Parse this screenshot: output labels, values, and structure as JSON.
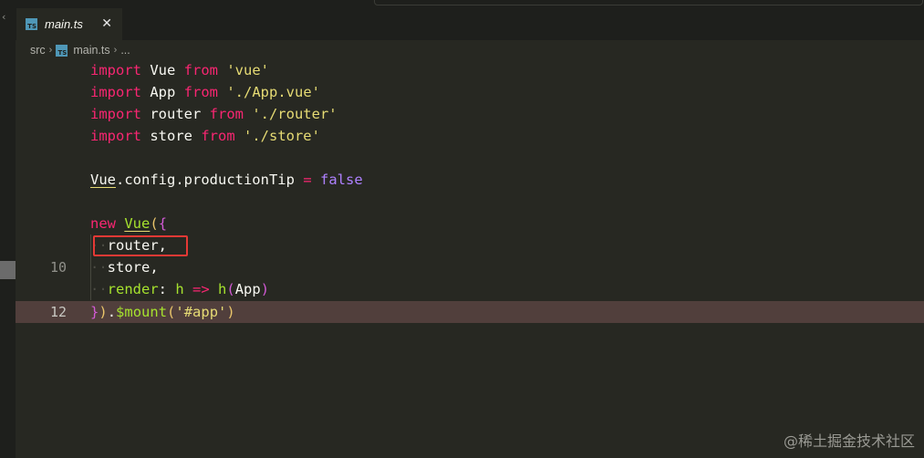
{
  "tab": {
    "label": "main.ts",
    "icon": "TS",
    "close": "✕"
  },
  "breadcrumb": {
    "segments": [
      "src",
      "main.ts",
      "..."
    ]
  },
  "line_numbers": {
    "l10": "10",
    "l12": "12"
  },
  "code": {
    "l1": [
      "import",
      " Vue ",
      "from",
      " 'vue'"
    ],
    "l2": [
      "import",
      " App ",
      "from",
      " './App.vue'"
    ],
    "l3": [
      "import",
      " router ",
      "from",
      " './router'"
    ],
    "l4": [
      "import",
      " store ",
      "from",
      " './store'"
    ],
    "l6": [
      "Vue",
      ".config.productionTip ",
      "=",
      " false"
    ],
    "l8": [
      "new",
      " ",
      "Vue",
      "(",
      "{"
    ],
    "l9": [
      "router,"
    ],
    "l10": [
      "store,"
    ],
    "l11": [
      "render",
      ": ",
      "h",
      " => ",
      "h",
      "(",
      "App",
      ")"
    ],
    "l12": [
      "}",
      ")",
      ".",
      "$mount",
      "(",
      "'#app'",
      ")"
    ]
  },
  "watermark": "@稀土掘金技术社区",
  "colors": {
    "editor_bg": "#272822",
    "keyword": "#f92672",
    "string": "#e6db74",
    "function": "#a6e22e",
    "constant": "#ae81ff",
    "current_line": "#513f3c",
    "annotation_box": "#e53935"
  }
}
